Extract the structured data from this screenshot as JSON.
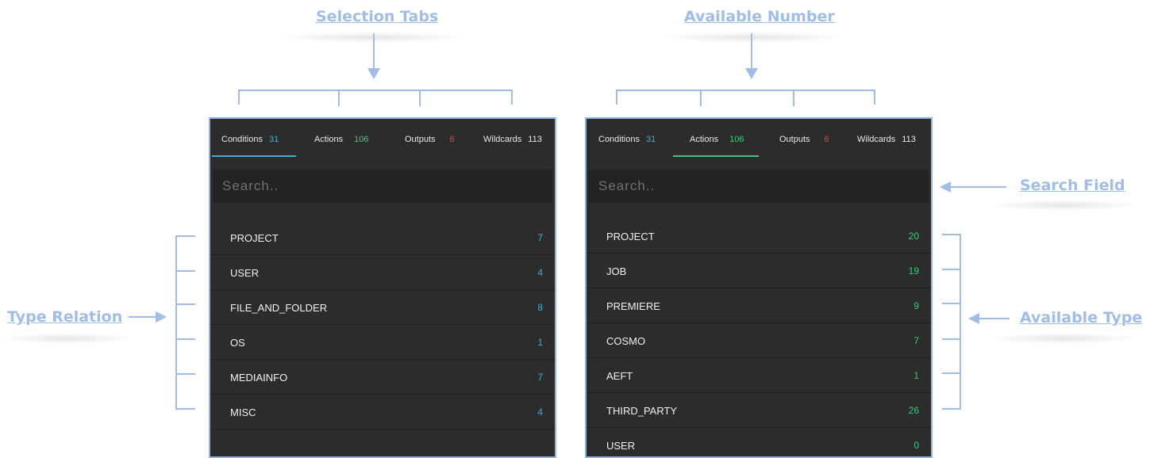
{
  "callouts": {
    "selection_tabs": "Selection Tabs",
    "available_number": "Available Number",
    "search_field": "Search Field",
    "type_relation": "Type Relation",
    "available_type": "Available Type"
  },
  "colors": {
    "annotation": "#9fbde6",
    "panel_bg": "#2c2c2c",
    "conditions_accent": "#49a9d6",
    "actions_accent": "#3fc87a",
    "outputs_accent": "#e0473a"
  },
  "left_panel": {
    "active_tab": "conditions",
    "tabs": [
      {
        "label": "Conditions",
        "count": "31"
      },
      {
        "label": "Actions",
        "count": "106"
      },
      {
        "label": "Outputs",
        "count": "6"
      },
      {
        "label": "Wildcards",
        "count": "113"
      }
    ],
    "search_placeholder": "Search..",
    "items": [
      {
        "label": "PROJECT",
        "count": "7"
      },
      {
        "label": "USER",
        "count": "4"
      },
      {
        "label": "FILE_AND_FOLDER",
        "count": "8"
      },
      {
        "label": "OS",
        "count": "1"
      },
      {
        "label": "MEDIAINFO",
        "count": "7"
      },
      {
        "label": "MISC",
        "count": "4"
      }
    ]
  },
  "right_panel": {
    "active_tab": "actions",
    "tabs": [
      {
        "label": "Conditions",
        "count": "31"
      },
      {
        "label": "Actions",
        "count": "106"
      },
      {
        "label": "Outputs",
        "count": "6"
      },
      {
        "label": "Wildcards",
        "count": "113"
      }
    ],
    "search_placeholder": "Search..",
    "items": [
      {
        "label": "PROJECT",
        "count": "20"
      },
      {
        "label": "JOB",
        "count": "19"
      },
      {
        "label": "PREMIERE",
        "count": "9"
      },
      {
        "label": "COSMO",
        "count": "7"
      },
      {
        "label": "AEFT",
        "count": "1"
      },
      {
        "label": "THIRD_PARTY",
        "count": "26"
      },
      {
        "label": "USER",
        "count": "0"
      }
    ]
  }
}
